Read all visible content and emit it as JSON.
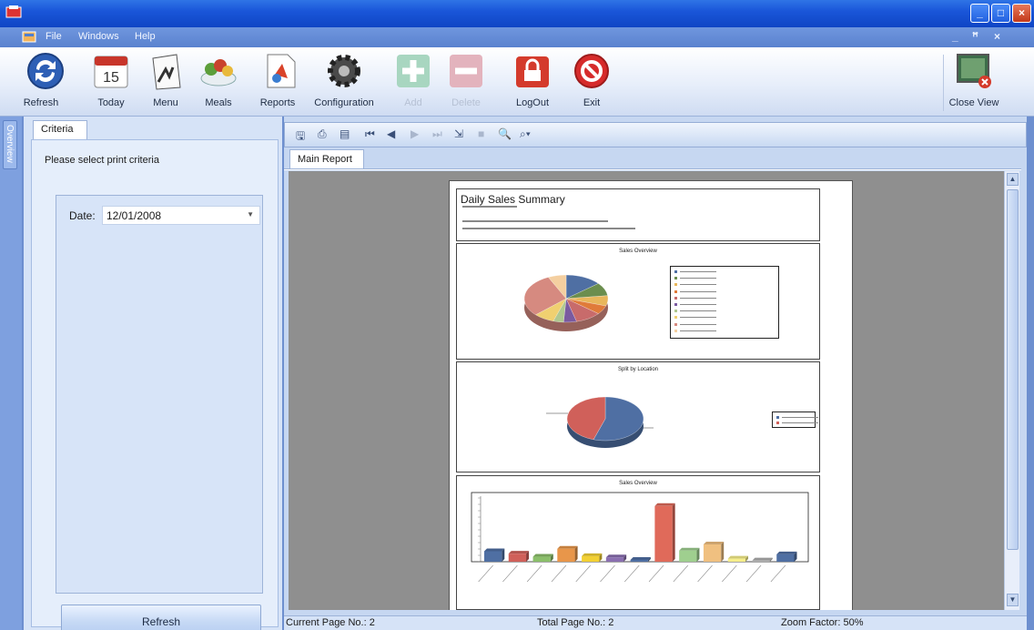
{
  "menu": {
    "items": [
      "File",
      "Windows",
      "Help"
    ],
    "mdi_min": "_",
    "mdi_restore": "̸",
    "mdi_close": "×"
  },
  "toolbar": {
    "refresh": "Refresh",
    "today": "Today",
    "today_date": "15",
    "menu": "Menu",
    "meals": "Meals",
    "reports": "Reports",
    "configuration": "Configuration",
    "add": "Add",
    "delete": "Delete",
    "logout": "LogOut",
    "exit": "Exit",
    "close_view": "Close View"
  },
  "sidebar": {
    "overview": "Overview"
  },
  "criteria": {
    "tab": "Criteria",
    "title": "Please select print criteria",
    "date_label": "Date:",
    "date_value": "12/01/2008",
    "refresh_button": "Refresh"
  },
  "viewer": {
    "tab": "Main Report",
    "status_current": "Current Page No.: 2",
    "status_total": "Total Page No.: 2",
    "status_zoom": "Zoom Factor: 50%"
  },
  "report": {
    "title": "Daily Sales Summary",
    "chart1_title": "Sales Overview",
    "chart2_title": "Split by Location",
    "chart3_title": "Sales Overview"
  },
  "chart_data": [
    {
      "type": "pie",
      "title": "Sales Overview",
      "values": [
        14,
        9,
        7,
        6,
        10,
        5,
        4,
        8,
        30,
        7
      ],
      "colors": [
        "#4f6fa3",
        "#6b8e4e",
        "#e8b75c",
        "#e07b3a",
        "#c86b6b",
        "#7a5aa0",
        "#b0c890",
        "#f0d070",
        "#d68a80",
        "#f4cfa0"
      ]
    },
    {
      "type": "pie",
      "title": "Split by Location",
      "values": [
        55,
        45
      ],
      "colors": [
        "#4f6fa3",
        "#d0605a"
      ]
    },
    {
      "type": "bar",
      "title": "Sales Overview",
      "values": [
        17,
        13,
        8,
        21,
        9,
        7,
        3,
        90,
        18,
        28,
        5,
        2,
        12
      ],
      "colors": [
        "#4f6fa3",
        "#d0605a",
        "#8bbf6a",
        "#e8964a",
        "#f2d033",
        "#8a6fb0",
        "#4f6fa3",
        "#e06a5a",
        "#9fcf8f",
        "#f0c080",
        "#f6ee8a",
        "#b0b0b0",
        "#4f6fa3"
      ],
      "ylim": [
        0,
        100
      ]
    }
  ]
}
